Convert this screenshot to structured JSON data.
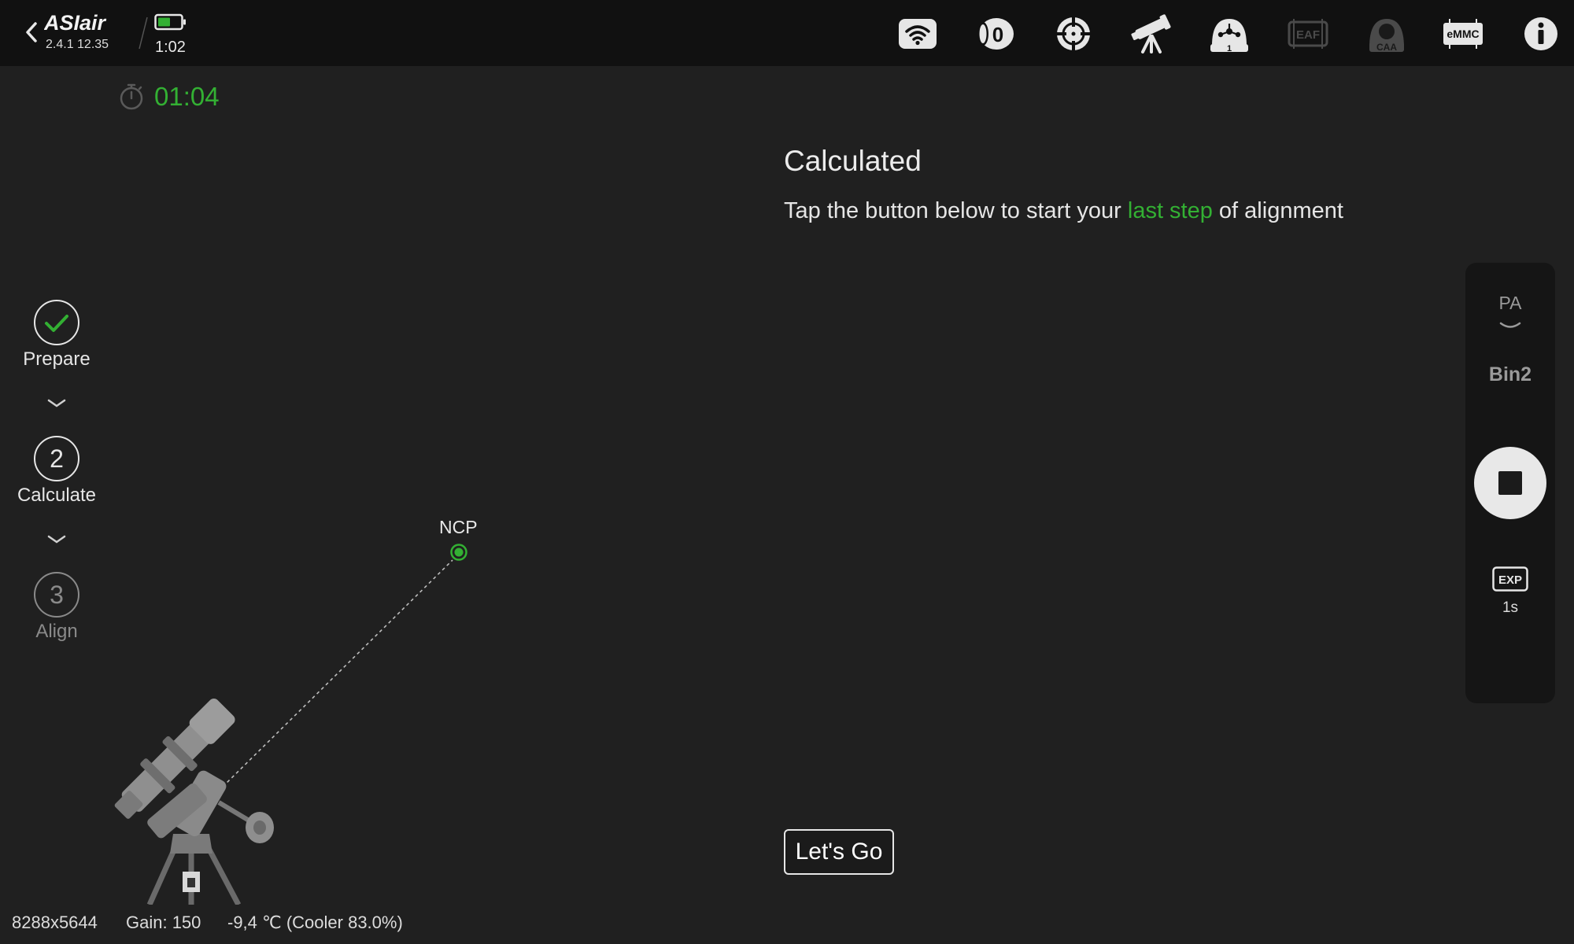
{
  "header": {
    "app_name": "ASIair",
    "version": "2.4.1 12.35",
    "battery_time": "1:02",
    "icons": [
      "wifi-icon",
      "storage-icon",
      "target-icon",
      "telescope-icon",
      "mount-icon",
      "eaf-icon",
      "caa-icon",
      "emmc-icon",
      "info-icon"
    ],
    "icon_text": {
      "eaf": "EAF",
      "caa": "CAA",
      "emmc": "eMMC",
      "mount_count": "1",
      "storage_count": "0"
    }
  },
  "timer": "01:04",
  "main": {
    "title": "Calculated",
    "subtitle_before": "Tap the button below to start your ",
    "subtitle_highlight": "last step",
    "subtitle_after": " of alignment",
    "button": "Let's Go"
  },
  "steps": [
    {
      "number": "",
      "label": "Prepare",
      "state": "done"
    },
    {
      "number": "2",
      "label": "Calculate",
      "state": "active"
    },
    {
      "number": "3",
      "label": "Align",
      "state": "pending"
    }
  ],
  "ncp_label": "NCP",
  "status": {
    "resolution": "8288x5644",
    "gain": "Gain: 150",
    "temperature": "-9,4 ℃ (Cooler 83.0%)"
  },
  "right_panel": {
    "mode": "PA",
    "bin": "Bin2",
    "exp_label": "EXP",
    "exp_value": "1s"
  },
  "colors": {
    "accent": "#33b033",
    "background": "#202020",
    "topbar": "#111111",
    "panel": "#151515"
  }
}
